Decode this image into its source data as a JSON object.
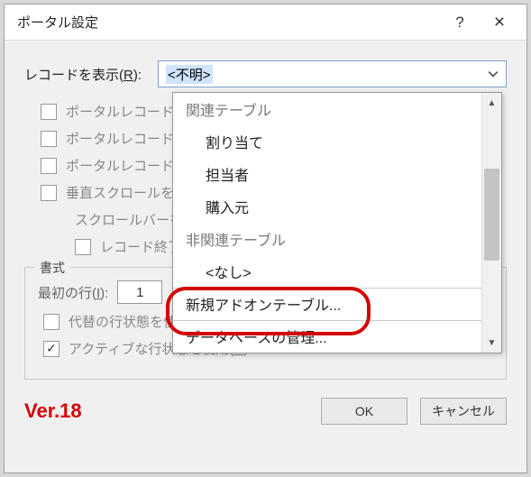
{
  "titlebar": {
    "title": "ポータル設定",
    "help_icon": "?",
    "close_icon": "×"
  },
  "records_label": "レコードを表示(R):",
  "combo_selected": "<不明>",
  "checkboxes": {
    "c1": "ポータルレコードの",
    "c2": "ポータルレコードの",
    "c3": "ポータルレコードの",
    "c4": "垂直スクロールを",
    "c4b": "スクロールバーを表",
    "c5": "レコード終了"
  },
  "fieldset": {
    "legend": "書式",
    "first_row_label": "最初の行(I):",
    "first_row_value": "1",
    "alt_row": "代替の行状態を使用(A)",
    "active_row": "アクティブな行状態を使用(C)"
  },
  "version": "Ver.18",
  "buttons": {
    "ok": "OK",
    "cancel": "キャンセル"
  },
  "dropdown": {
    "group_related": "関連テーブル",
    "opt1": "割り当て",
    "opt2": "担当者",
    "opt3": "購入元",
    "group_unrelated": "非関連テーブル",
    "opt_none": "<なし>",
    "opt_new_addon": "新規アドオンテーブル...",
    "opt_db_manage": "データベースの管理..."
  }
}
